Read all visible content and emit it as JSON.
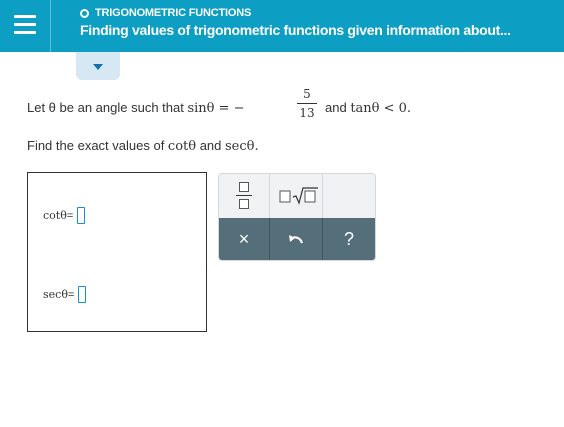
{
  "header": {
    "topic": "TRIGONOMETRIC FUNCTIONS",
    "title": "Finding values of trigonometric functions given information about..."
  },
  "problem": {
    "line1_prefix": "Let θ be an angle such that ",
    "line1_sin": "sinθ = −",
    "fraction_numerator": "5",
    "fraction_denominator": "13",
    "line1_and": "and ",
    "line1_tan": "tanθ < 0.",
    "line2_prefix": "Find the exact values of ",
    "line2_cot": "cotθ",
    "line2_and": " and ",
    "line2_sec": "secθ."
  },
  "answers": {
    "cot_label": "cotθ",
    "cot_eq": " =",
    "cot_value": "",
    "sec_label": "secθ",
    "sec_eq": " =",
    "sec_value": ""
  },
  "palette": {
    "tools": [
      "fraction-icon",
      "square-root-icon"
    ],
    "clear_label": "×",
    "undo_icon": "undo-icon",
    "help_label": "?"
  },
  "colors": {
    "header_bg": "#0d9ec4",
    "collapse_tab": "#d6e8f3",
    "palette_actions_bg": "#546e7a",
    "input_border": "#1a8fd0"
  }
}
